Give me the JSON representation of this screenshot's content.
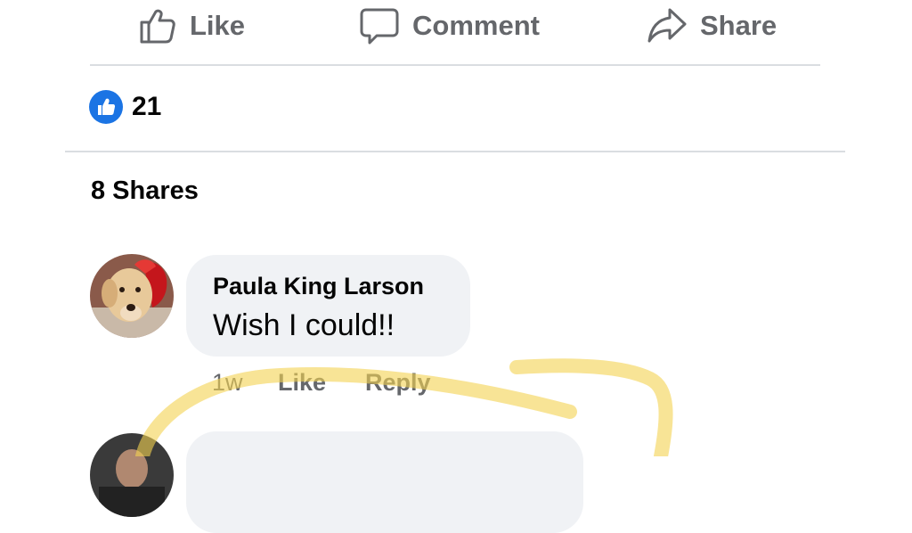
{
  "actions": {
    "like_label": "Like",
    "comment_label": "Comment",
    "share_label": "Share"
  },
  "reactions": {
    "count": "21",
    "icon": "thumbs-up-icon"
  },
  "shares_label": "8 Shares",
  "comments": [
    {
      "author": "Paula King Larson",
      "text": "Wish I could!!",
      "time": "1w",
      "like_label": "Like",
      "reply_label": "Reply"
    }
  ],
  "colors": {
    "accent": "#1b74e4",
    "muted_text": "#65676b",
    "bubble": "#f0f2f5",
    "highlighter": "#f3d250"
  }
}
